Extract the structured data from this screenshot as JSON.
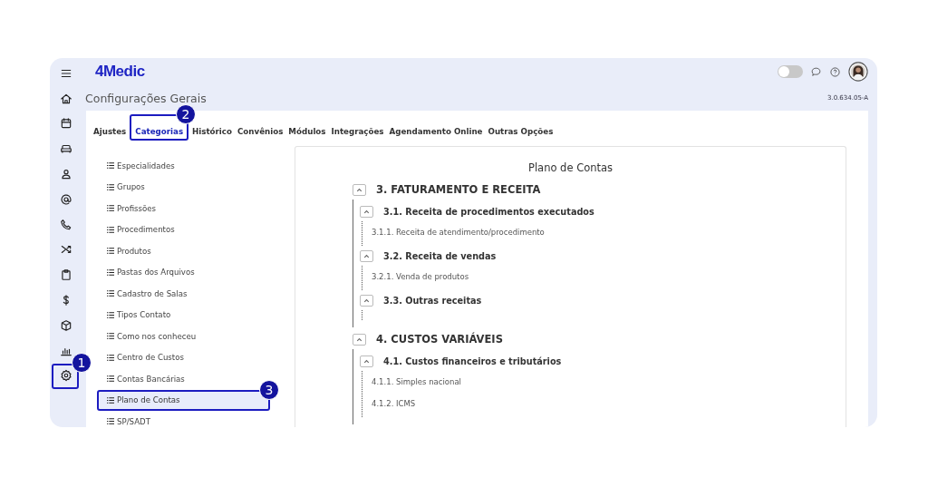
{
  "rail": [
    {
      "kind": "menu"
    },
    {
      "kind": "home"
    },
    {
      "kind": "calendar"
    },
    {
      "kind": "sofa"
    },
    {
      "kind": "person"
    },
    {
      "kind": "at"
    },
    {
      "kind": "phone"
    },
    {
      "kind": "shuffle"
    },
    {
      "kind": "clipboard"
    },
    {
      "kind": "dollar"
    },
    {
      "kind": "box"
    },
    {
      "kind": "chart"
    },
    {
      "kind": "gear",
      "callout": "1"
    }
  ],
  "header": {
    "logo": "4Medic",
    "toggle": {
      "on": false
    }
  },
  "page": {
    "title": "Configurações Gerais",
    "version": "3.0.634.05-A"
  },
  "tabs": [
    {
      "label": "Ajustes",
      "selected": false
    },
    {
      "label": "Categorias",
      "selected": true,
      "callout": "2"
    },
    {
      "label": "Histórico",
      "selected": false
    },
    {
      "label": "Convênios",
      "selected": false
    },
    {
      "label": "Módulos",
      "selected": false
    },
    {
      "label": "Integrações",
      "selected": false
    },
    {
      "label": "Agendamento Online",
      "selected": false
    },
    {
      "label": "Outras Opções",
      "selected": false
    }
  ],
  "categories": [
    {
      "label": "Especialidades",
      "selected": false
    },
    {
      "label": "Grupos",
      "selected": false
    },
    {
      "label": "Profissões",
      "selected": false
    },
    {
      "label": "Procedimentos",
      "selected": false
    },
    {
      "label": "Produtos",
      "selected": false
    },
    {
      "label": "Pastas dos Arquivos",
      "selected": false
    },
    {
      "label": "Cadastro de Salas",
      "selected": false
    },
    {
      "label": "Tipos Contato",
      "selected": false
    },
    {
      "label": "Como nos conheceu",
      "selected": false
    },
    {
      "label": "Centro de Custos",
      "selected": false
    },
    {
      "label": "Contas Bancárias",
      "selected": false
    },
    {
      "label": "Plano de Contas",
      "selected": true,
      "callout": "3"
    },
    {
      "label": "SP/SADT",
      "selected": false
    }
  ],
  "accounts": {
    "title": "Plano de Contas",
    "tree": [
      {
        "label": "3. FATURAMENTO E RECEITA",
        "expanded": true,
        "children": [
          {
            "label": "3.1. Receita de procedimentos executados",
            "expanded": true,
            "children": [
              {
                "label": "3.1.1. Receita de atendimento/procedimento"
              }
            ]
          },
          {
            "label": "3.2. Receita de vendas",
            "expanded": true,
            "children": [
              {
                "label": "3.2.1. Venda de produtos"
              }
            ]
          },
          {
            "label": "3.3. Outras receitas",
            "expanded": true
          }
        ]
      },
      {
        "label": "4. CUSTOS VARIÁVEIS",
        "expanded": true,
        "children": [
          {
            "label": "4.1. Custos financeiros e tributários",
            "expanded": true,
            "children": [
              {
                "label": "4.1.1. Simples nacional"
              },
              {
                "label": "4.1.2. ICMS"
              }
            ]
          }
        ]
      }
    ]
  }
}
